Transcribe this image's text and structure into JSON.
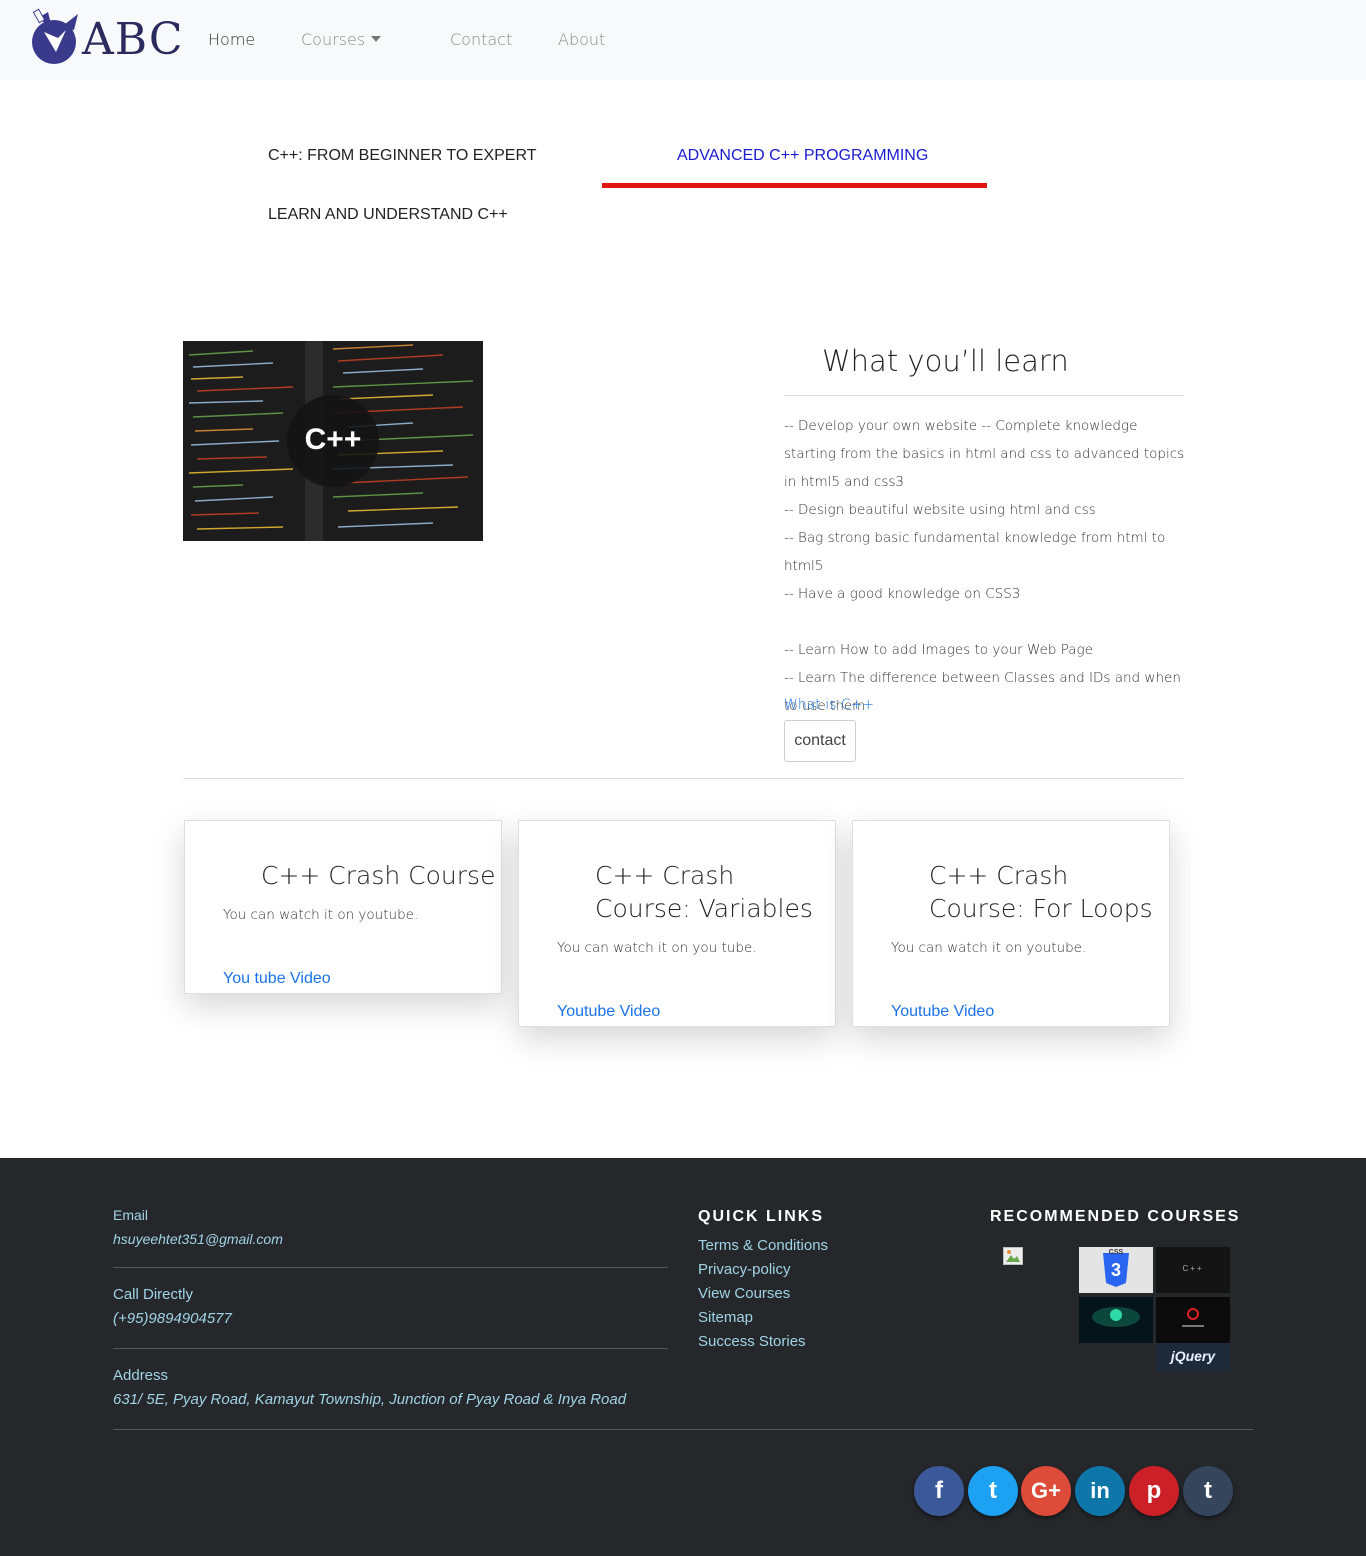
{
  "brand": {
    "name": "ABC",
    "logo_color": "#3a3a8c"
  },
  "nav": {
    "home": "Home",
    "courses": "Courses",
    "contact": "Contact",
    "about": "About"
  },
  "tabs": [
    {
      "label": "C++: FROM BEGINNER TO EXPERT",
      "active": false
    },
    {
      "label": "ADVANCED C++ PROGRAMMING",
      "active": true
    },
    {
      "label": "LEARN AND UNDERSTAND C++",
      "active": false
    }
  ],
  "hero": {
    "image_label": "C++",
    "learn_title": "What you’ll learn",
    "learn_items": [
      "-- Develop your own website -- Complete knowledge starting from the basics in html and css to advanced topics in html5 and css3",
      "-- Design beautiful website using html and css",
      "-- Bag strong basic fundamental knowledge from html to html5",
      "-- Have a good knowledge on CSS3",
      "",
      "-- Learn How to add Images to your Web Page",
      "-- Learn The difference between Classes and IDs and when to use them"
    ],
    "what_link": "What is C++",
    "contact_button": "contact"
  },
  "cards": [
    {
      "title": "C++ Crash Course",
      "text": "You can watch it on youtube.",
      "link": "You tube Video"
    },
    {
      "title": "C++ Crash Course: Variables",
      "text": "You can watch it on you tube.",
      "link": "Youtube Video"
    },
    {
      "title": "C++ Crash Course: For Loops",
      "text": "You can watch it on youtube.",
      "link": "Youtube Video"
    }
  ],
  "footer": {
    "email_label": "Email",
    "email_value": "hsuyeehtet351@gmail.com",
    "call_label": "Call Directly",
    "call_value": "(+95)9894904577",
    "address_label": "Address",
    "address_value": "631/ 5E, Pyay Road, Kamayut Township, Junction of Pyay Road & Inya Road",
    "quick_links_heading": "QUICK LINKS",
    "quick_links": [
      "Terms & Conditions",
      "Privacy-policy",
      "View Courses",
      "Sitemap",
      "Success Stories"
    ],
    "recommended_heading": "RECOMMENDED COURSES",
    "thumb_labels": {
      "css": "CSS",
      "css_num": "3",
      "cpp": "C++",
      "jquery": "jQuery"
    },
    "socials": [
      {
        "name": "facebook",
        "glyph": "f",
        "color": "#3b5998"
      },
      {
        "name": "twitter",
        "glyph": "t",
        "color": "#1da1f2"
      },
      {
        "name": "google-plus",
        "glyph": "G+",
        "color": "#dd4b39"
      },
      {
        "name": "linkedin",
        "glyph": "in",
        "color": "#0e76a8"
      },
      {
        "name": "pinterest",
        "glyph": "p",
        "color": "#cb2027"
      },
      {
        "name": "tumblr",
        "glyph": "t",
        "color": "#35465c"
      }
    ]
  }
}
